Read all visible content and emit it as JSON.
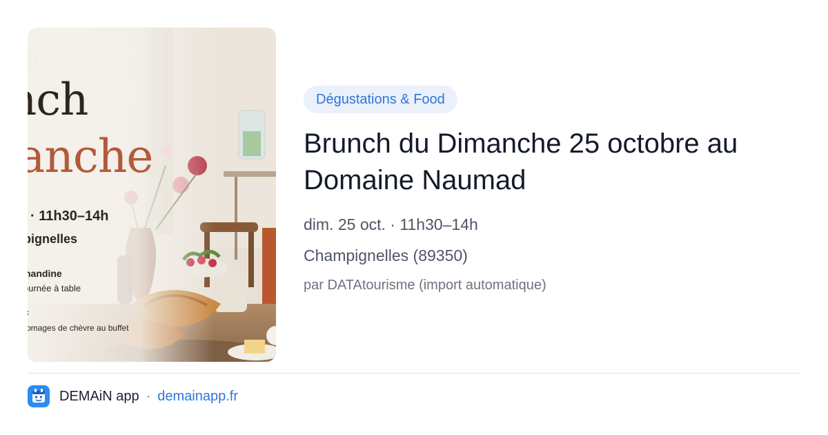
{
  "image": {
    "poster_lines": {
      "line1": "nch",
      "line2": "anche",
      "time": "· 11h30–14h",
      "place": "pignelles",
      "sub1": "nandine",
      "sub2": "ournée à table",
      "sub3": "c",
      "sub4": "romages de chèvre au buffet"
    }
  },
  "event": {
    "category": "Dégustations & Food",
    "title": "Brunch du Dimanche 25 octobre au Domaine Naumad",
    "date": "dim. 25 oct. · 11h30–14h",
    "location": "Champignelles (89350)",
    "source": "par DATAtourisme (import automatique)"
  },
  "footer": {
    "app_name": "DEMAiN app",
    "separator": "·",
    "domain": "demainapp.fr",
    "icon": "demain-app-logo-icon"
  },
  "colors": {
    "accent": "#2f75d6",
    "category_bg": "#eaf1fb",
    "brand_icon": "#2d8cf0"
  }
}
